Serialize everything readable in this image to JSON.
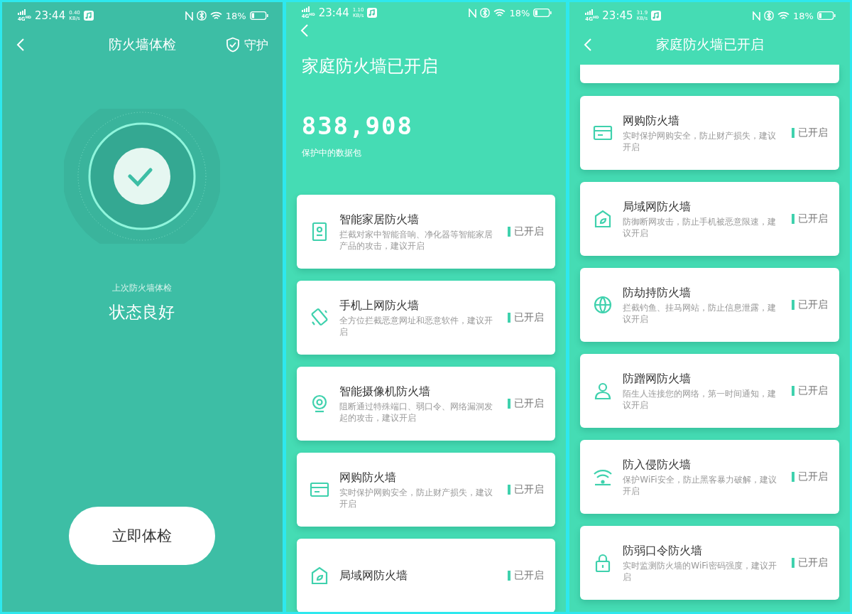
{
  "screens": [
    {
      "kind": "check",
      "status_bar": {
        "network": "4G",
        "network_sub": "HD",
        "time": "23:44",
        "speed": "0.40",
        "speed_unit": "KB/s",
        "battery": "18%"
      },
      "header": {
        "title": "防火墙体检",
        "action": "守护"
      },
      "last_check_label": "上次防火墙体检",
      "status": "状态良好",
      "button": "立即体检"
    },
    {
      "kind": "list",
      "status_bar": {
        "network": "4G",
        "network_sub": "HD",
        "time": "23:44",
        "speed": "1.10",
        "speed_unit": "KB/s",
        "battery": "18%"
      },
      "heading": "家庭防火墙已开启",
      "counter": "838,908",
      "counter_label": "保护中的数据包",
      "cards": [
        {
          "kind": "speaker",
          "title": "智能家居防火墙",
          "desc": "拦截对家中智能音响、净化器等智能家居产品的攻击，建议开启",
          "state": "已开启",
          "enabled": true
        },
        {
          "kind": "phone",
          "title": "手机上网防火墙",
          "desc": "全方位拦截恶意网址和恶意软件，建议开启",
          "state": "已开启",
          "enabled": true
        },
        {
          "kind": "camera",
          "title": "智能摄像机防火墙",
          "desc": "阻断通过特殊端口、弱口令、网络漏洞发起的攻击，建议开启",
          "state": "已开启",
          "enabled": true
        },
        {
          "kind": "card",
          "title": "网购防火墙",
          "desc": "实时保护网购安全，防止财产损失，建议开启",
          "state": "已开启",
          "enabled": true
        },
        {
          "kind": "house",
          "title": "局域网防火墙",
          "state": "已开启",
          "enabled": true
        }
      ]
    },
    {
      "kind": "scrolled",
      "status_bar": {
        "network": "4G",
        "network_sub": "HD",
        "time": "23:45",
        "speed": "31.9",
        "speed_unit": "KB/s",
        "battery": "18%"
      },
      "header": {
        "title": "家庭防火墙已开启"
      },
      "cards": [
        {
          "kind": "card",
          "title": "网购防火墙",
          "desc": "实时保护网购安全，防止财产损失，建议开启",
          "state": "已开启",
          "enabled": true
        },
        {
          "kind": "house",
          "title": "局域网防火墙",
          "desc": "防御断网攻击，防止手机被恶意限速，建议开启",
          "state": "已开启",
          "enabled": true
        },
        {
          "kind": "globe",
          "title": "防劫持防火墙",
          "desc": "拦截钓鱼、挂马网站，防止信息泄露，建议开启",
          "state": "已开启",
          "enabled": true
        },
        {
          "kind": "person",
          "title": "防蹭网防火墙",
          "desc": "陌生人连接您的网络，第一时间通知，建议开启",
          "state": "已开启",
          "enabled": true
        },
        {
          "kind": "wifi",
          "title": "防入侵防火墙",
          "desc": "保护WiFi安全，防止黑客暴力破解，建议开启",
          "state": "已开启",
          "enabled": true
        },
        {
          "kind": "lock",
          "title": "防弱口令防火墙",
          "desc": "实时监测防火墙的WiFi密码强度，建议开启",
          "state": "已开启",
          "enabled": true
        }
      ]
    }
  ]
}
